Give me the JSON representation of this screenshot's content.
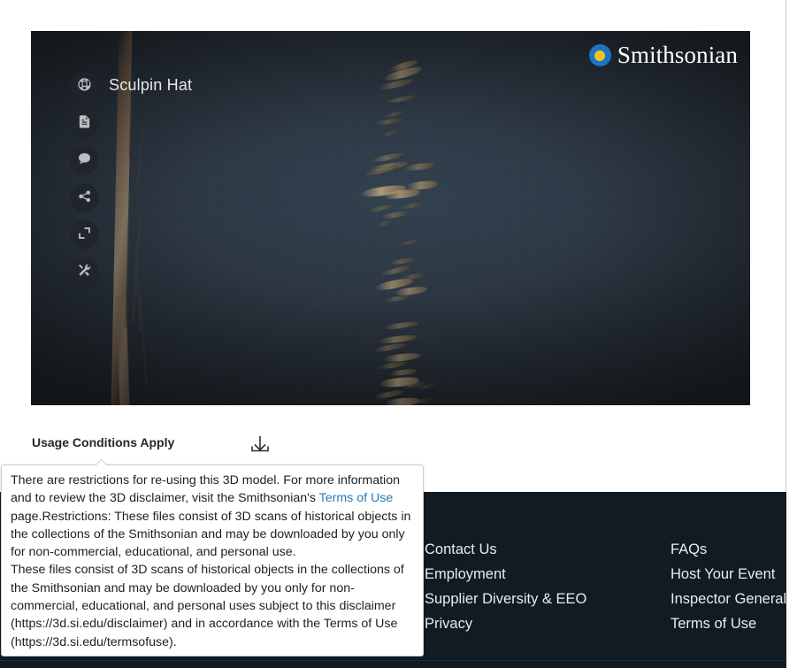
{
  "viewer": {
    "title": "Sculpin Hat",
    "brand": "Smithsonian",
    "brand_mark_icon": "smithsonian-sunburst-icon",
    "colors": {
      "brand_blue": "#1b74c4",
      "brand_yellow": "#f7c21b",
      "background": "#2b3642"
    },
    "rail": [
      {
        "icon": "globe-icon",
        "name": "tour-button"
      },
      {
        "icon": "document-icon",
        "name": "article-button"
      },
      {
        "icon": "comment-icon",
        "name": "annotation-button"
      },
      {
        "icon": "share-icon",
        "name": "share-button"
      },
      {
        "icon": "fullscreen-icon",
        "name": "fullscreen-button"
      },
      {
        "icon": "tools-icon",
        "name": "tools-button"
      }
    ]
  },
  "usage": {
    "label": "Usage Conditions Apply",
    "download_icon": "download-icon"
  },
  "tooltip": {
    "p1_before_link": "There are restrictions for re-using this 3D model. For more information and to review the 3D disclaimer, visit the Smithsonian's ",
    "link_text": "Terms of Use",
    "p1_after_link": " page.Restrictions: These files consist of 3D scans of historical objects in the collections of the Smithsonian and may be downloaded by you only for non-commercial, educational, and personal use.",
    "p2": "These files consist of 3D scans of historical objects in the collections of the Smithsonian and may be downloaded by you only for non-commercial, educational, and personal uses subject to this disclaimer (https://3d.si.edu/disclaimer) and in accordance with the Terms of Use (https://3d.si.edu/termsofuse).",
    "link_color": "#2a7ab1"
  },
  "footer": {
    "background": "#111b23",
    "column2": [
      {
        "label": "Contact Us"
      },
      {
        "label": "Employment"
      },
      {
        "label": "Supplier Diversity & EEO"
      },
      {
        "label": "Privacy"
      }
    ],
    "column3": [
      {
        "label": "FAQs"
      },
      {
        "label": "Host Your Event"
      },
      {
        "label": "Inspector General"
      },
      {
        "label": "Terms of Use"
      }
    ]
  }
}
